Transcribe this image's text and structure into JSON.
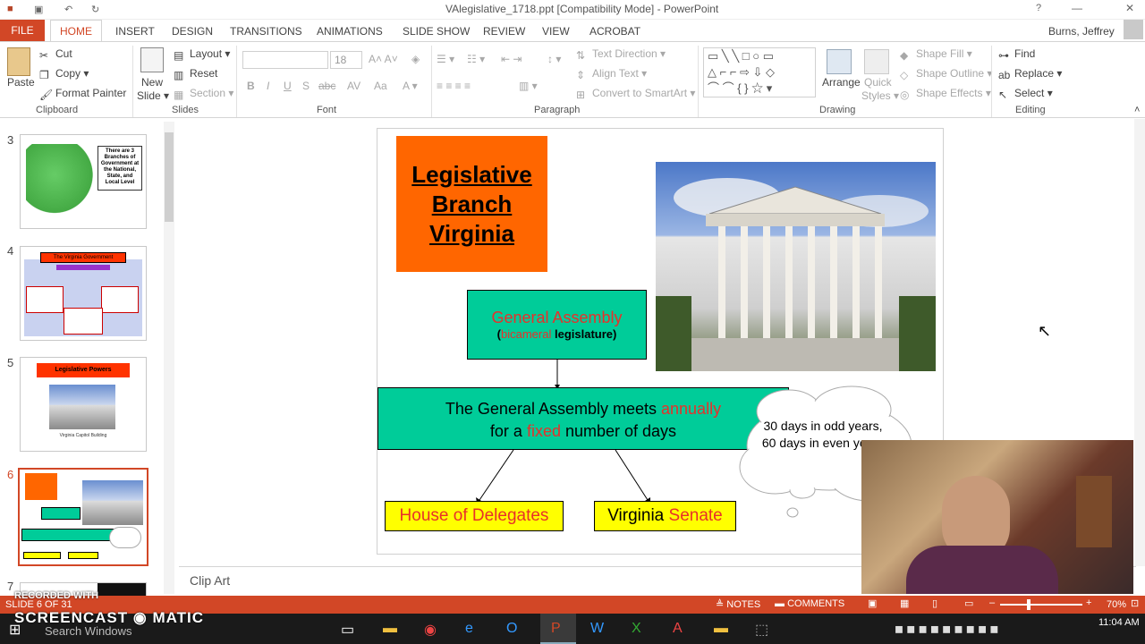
{
  "window": {
    "title": "VAlegislative_1718.ppt [Compatibility Mode] - PowerPoint",
    "user": "Burns, Jeffrey"
  },
  "tabs": [
    "FILE",
    "HOME",
    "INSERT",
    "DESIGN",
    "TRANSITIONS",
    "ANIMATIONS",
    "SLIDE SHOW",
    "REVIEW",
    "VIEW",
    "ACROBAT"
  ],
  "ribbon": {
    "clipboard": {
      "paste": "Paste",
      "cut": "Cut",
      "copy": "Copy",
      "format_painter": "Format Painter",
      "label": "Clipboard"
    },
    "slides": {
      "new_slide_line1": "New",
      "new_slide_line2": "Slide",
      "layout": "Layout",
      "reset": "Reset",
      "section": "Section",
      "label": "Slides"
    },
    "font": {
      "size": "18",
      "label": "Font"
    },
    "paragraph": {
      "text_direction": "Text Direction",
      "align_text": "Align Text",
      "convert_smartart": "Convert to SmartArt",
      "label": "Paragraph"
    },
    "drawing": {
      "arrange": "Arrange",
      "quick_styles_line1": "Quick",
      "quick_styles_line2": "Styles",
      "shape_fill": "Shape Fill",
      "shape_outline": "Shape Outline",
      "shape_effects": "Shape Effects",
      "label": "Drawing"
    },
    "editing": {
      "find": "Find",
      "replace": "Replace",
      "select": "Select",
      "label": "Editing"
    }
  },
  "thumbnails": [
    {
      "num": "3",
      "text": "There are 3 Branches of Government at the National, State, and Local Level"
    },
    {
      "num": "4",
      "text": "The Virginia Government"
    },
    {
      "num": "5",
      "text": "Legislative Powers",
      "caption": "Virginia Capitol Building"
    },
    {
      "num": "6"
    },
    {
      "num": "7"
    }
  ],
  "slide": {
    "title": "Legislative Branch Virginia",
    "ga_title": "General Assembly",
    "ga_paren_open": "(",
    "ga_bicameral": "bicameral",
    "ga_legislature": " legislature)",
    "meets_pre": "The General Assembly meets ",
    "meets_annually": "annually",
    "meets_for": "for a ",
    "meets_fixed": "fixed",
    "meets_post": " number of days",
    "cloud_text": "30 days in odd years, 60 days in even years",
    "house_red": "House of Delegates",
    "senate_black": "Virginia ",
    "senate_red": "Senate"
  },
  "notes": {
    "text": "Clip Art"
  },
  "status": {
    "slide_info": "SLIDE 6 OF 31",
    "notes": "NOTES",
    "comments": "COMMENTS",
    "zoom": "70%"
  },
  "taskbar": {
    "search": "Search Windows",
    "time": "11:04 AM"
  },
  "watermark": {
    "recorded": "RECORDED WITH",
    "brand_a": "SCREENCAST",
    "brand_b": "MATIC"
  },
  "colors": {
    "accent": "#d24726",
    "orange": "#ff6600",
    "teal": "#00cc99",
    "yellow": "#ffff00",
    "red": "#e8302a"
  }
}
